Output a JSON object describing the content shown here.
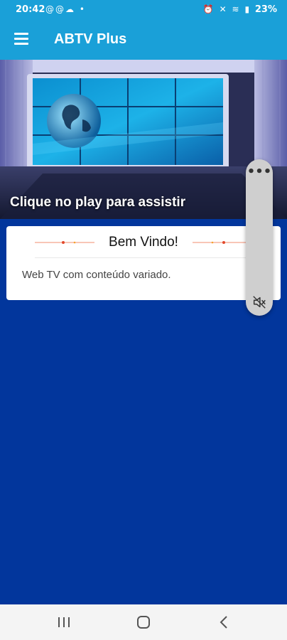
{
  "status_bar": {
    "time": "20:42",
    "left_icons": [
      "at-notification-icon",
      "at-notification-icon",
      "cloud-icon",
      "dot-icon"
    ],
    "right_icons": [
      "alarm-icon",
      "mute-icon",
      "wifi-icon",
      "signal-icon"
    ],
    "battery": "23%"
  },
  "app_bar": {
    "title": "ABTV Plus",
    "menu_icon": "hamburger-menu-icon"
  },
  "player": {
    "caption": "Clique no play para assistir"
  },
  "welcome_card": {
    "title": "Bem Vindo!",
    "text": "Web TV com conteúdo variado."
  },
  "floating_panel": {
    "more_icon": "more-horizontal-icon",
    "sound_icon": "volume-off-icon"
  },
  "nav_bar": {
    "items": [
      "recent-apps-icon",
      "home-icon",
      "back-icon"
    ]
  },
  "colors": {
    "app_bar": "#1aa0d8",
    "background": "#02369c",
    "card": "#ffffff",
    "nav_bar": "#f4f4f4"
  }
}
